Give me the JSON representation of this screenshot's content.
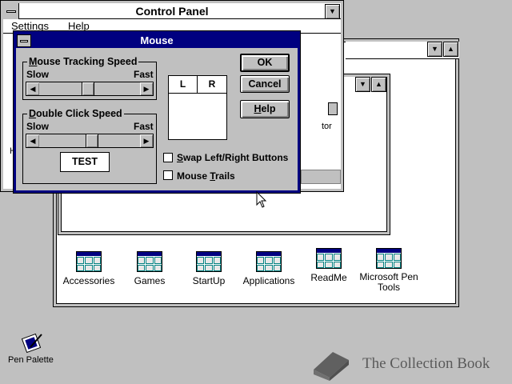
{
  "control_panel": {
    "title": "Control Panel",
    "menu": [
      "Settings",
      "Help"
    ],
    "partial_text_1": "tor",
    "partial_text_2": "H"
  },
  "mouse_dialog": {
    "title": "Mouse",
    "tracking": {
      "label_prefix": "",
      "label_hotkey": "M",
      "label_rest": "ouse Tracking Speed",
      "slow": "Slow",
      "fast": "Fast",
      "thumb_fraction": 0.48
    },
    "double_click": {
      "label_hotkey": "D",
      "label_rest": "ouble Click Speed",
      "slow": "Slow",
      "fast": "Fast",
      "thumb_fraction": 0.53,
      "test_label": "TEST"
    },
    "buttons_preview": {
      "left": "L",
      "right": "R"
    },
    "ok_label": "OK",
    "cancel_label": "Cancel",
    "help_hotkey": "H",
    "help_rest": "elp",
    "swap": {
      "hotkey": "S",
      "rest": "wap Left/Right Buttons",
      "checked": false
    },
    "trails": {
      "prefix": "Mouse ",
      "hotkey": "T",
      "rest": "rails",
      "checked": false
    }
  },
  "program_manager": {
    "groups": [
      {
        "label": "Accessories"
      },
      {
        "label": "Games"
      },
      {
        "label": "StartUp"
      },
      {
        "label": "Applications"
      },
      {
        "label": "ReadMe"
      },
      {
        "label": "Microsoft Pen Tools"
      }
    ]
  },
  "desktop": {
    "pen_palette_label": "Pen Palette",
    "watermark": "The Collection Book"
  },
  "colors": {
    "desktop": "#c0c0c0",
    "title_active": "#000080",
    "window": "#ffffff"
  }
}
